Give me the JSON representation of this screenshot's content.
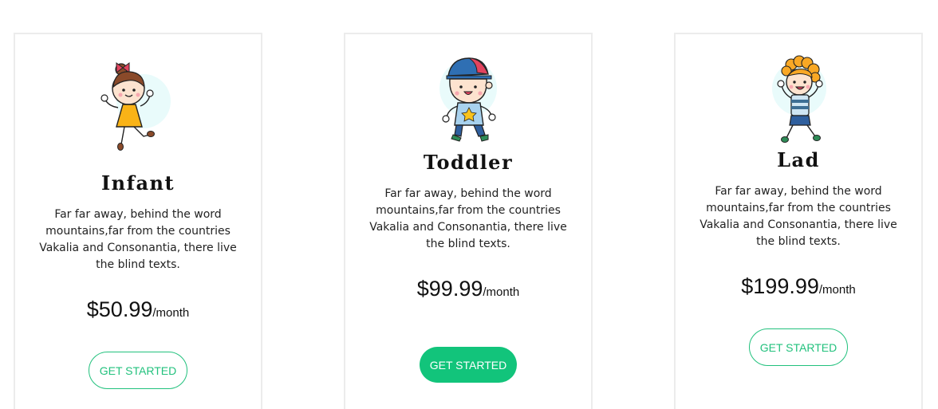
{
  "plans": [
    {
      "title": "Infant",
      "description": "Far far away, behind the word mountains,far from the countries Vakalia and Consonantia, there live the blind texts.",
      "price": "$50.99",
      "period": "/month",
      "button_label": "GET STARTED",
      "button_style": "outline",
      "illustration": "girl-illustration"
    },
    {
      "title": "Toddler",
      "description": "Far far away, behind the word mountains,far from the countries Vakalia and Consonantia, there live the blind texts.",
      "price": "$99.99",
      "period": "/month",
      "button_label": "GET STARTED",
      "button_style": "solid",
      "illustration": "boy-with-cap-illustration"
    },
    {
      "title": "Lad",
      "description": "Far far away, behind the word mountains,far from the countries Vakalia and Consonantia, there live the blind texts.",
      "price": "$199.99",
      "period": "/month",
      "button_label": "GET STARTED",
      "button_style": "outline",
      "illustration": "curly-boy-illustration"
    }
  ],
  "colors": {
    "accent": "#12c47b",
    "border": "#ececec",
    "text": "#111111"
  }
}
